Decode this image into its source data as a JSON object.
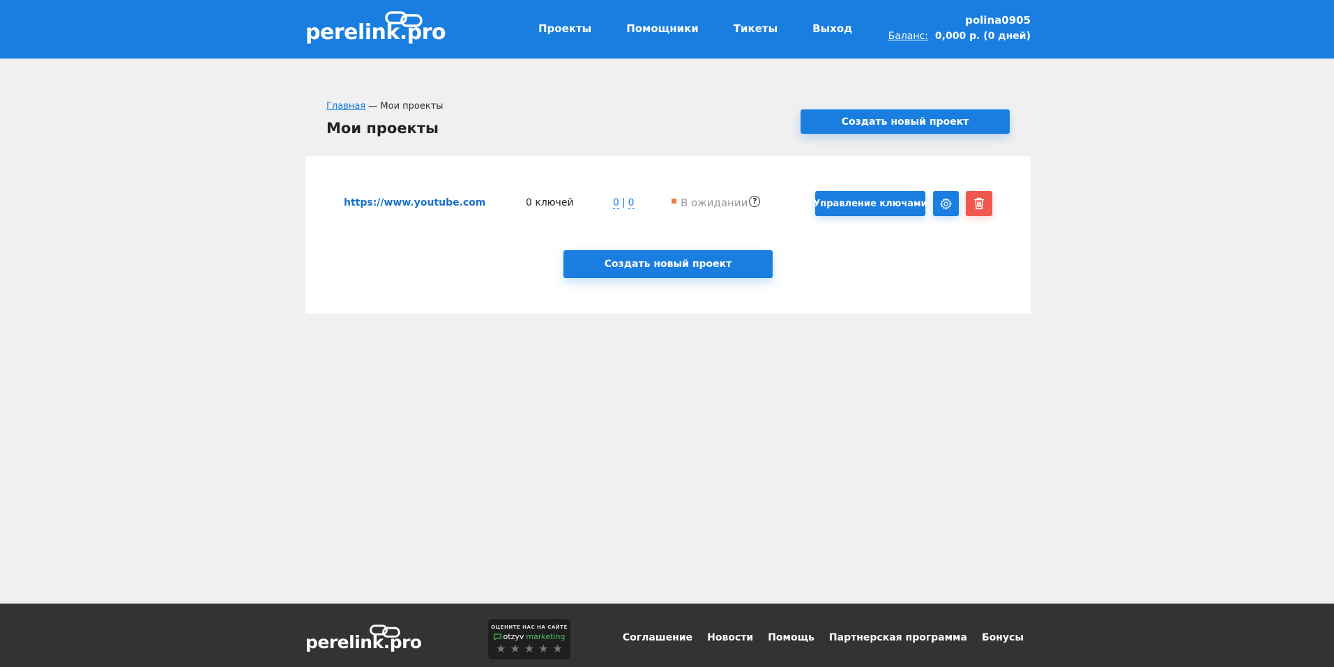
{
  "header": {
    "logo": "perelink.pro",
    "nav": [
      "Проекты",
      "Помощники",
      "Тикеты",
      "Выход"
    ],
    "username": "polina0905",
    "balance_label": "Баланс:",
    "balance_value": "0,000 р. (0 дней)"
  },
  "page": {
    "breadcrumb_home": "Главная",
    "breadcrumb_sep": " — ",
    "breadcrumb_current": "Мои проекты",
    "title": "Мои проекты",
    "create_button": "Создать новый проект"
  },
  "projects": [
    {
      "url": "https://www.youtube.com",
      "keys": "0 ключей",
      "count_a": "0",
      "count_sep": "|",
      "count_b": "0",
      "status": "В ожидании",
      "help_glyph": "?",
      "manage_button": "Управление ключами"
    }
  ],
  "card": {
    "create_button": "Создать новый проект"
  },
  "footer": {
    "logo": "perelink.pro",
    "rating_caption": "ОЦЕНИТЕ НАС НА САЙТЕ",
    "rating_brand_a": "otzyv",
    "rating_brand_b": "marketing",
    "rating_stars": "★★★★★",
    "nav": [
      "Соглашение",
      "Новости",
      "Помощь",
      "Партнерская программа",
      "Бонусы"
    ]
  },
  "colors": {
    "primary": "#1a7ee0",
    "danger": "#f0584d",
    "status_pending": "#f07a3a",
    "footer_bg": "#333333",
    "page_bg": "#f0f0f0"
  },
  "icons": [
    "chain-link-icon",
    "help-icon",
    "gear-icon",
    "trash-icon",
    "chat-icon",
    "star-icon"
  ]
}
